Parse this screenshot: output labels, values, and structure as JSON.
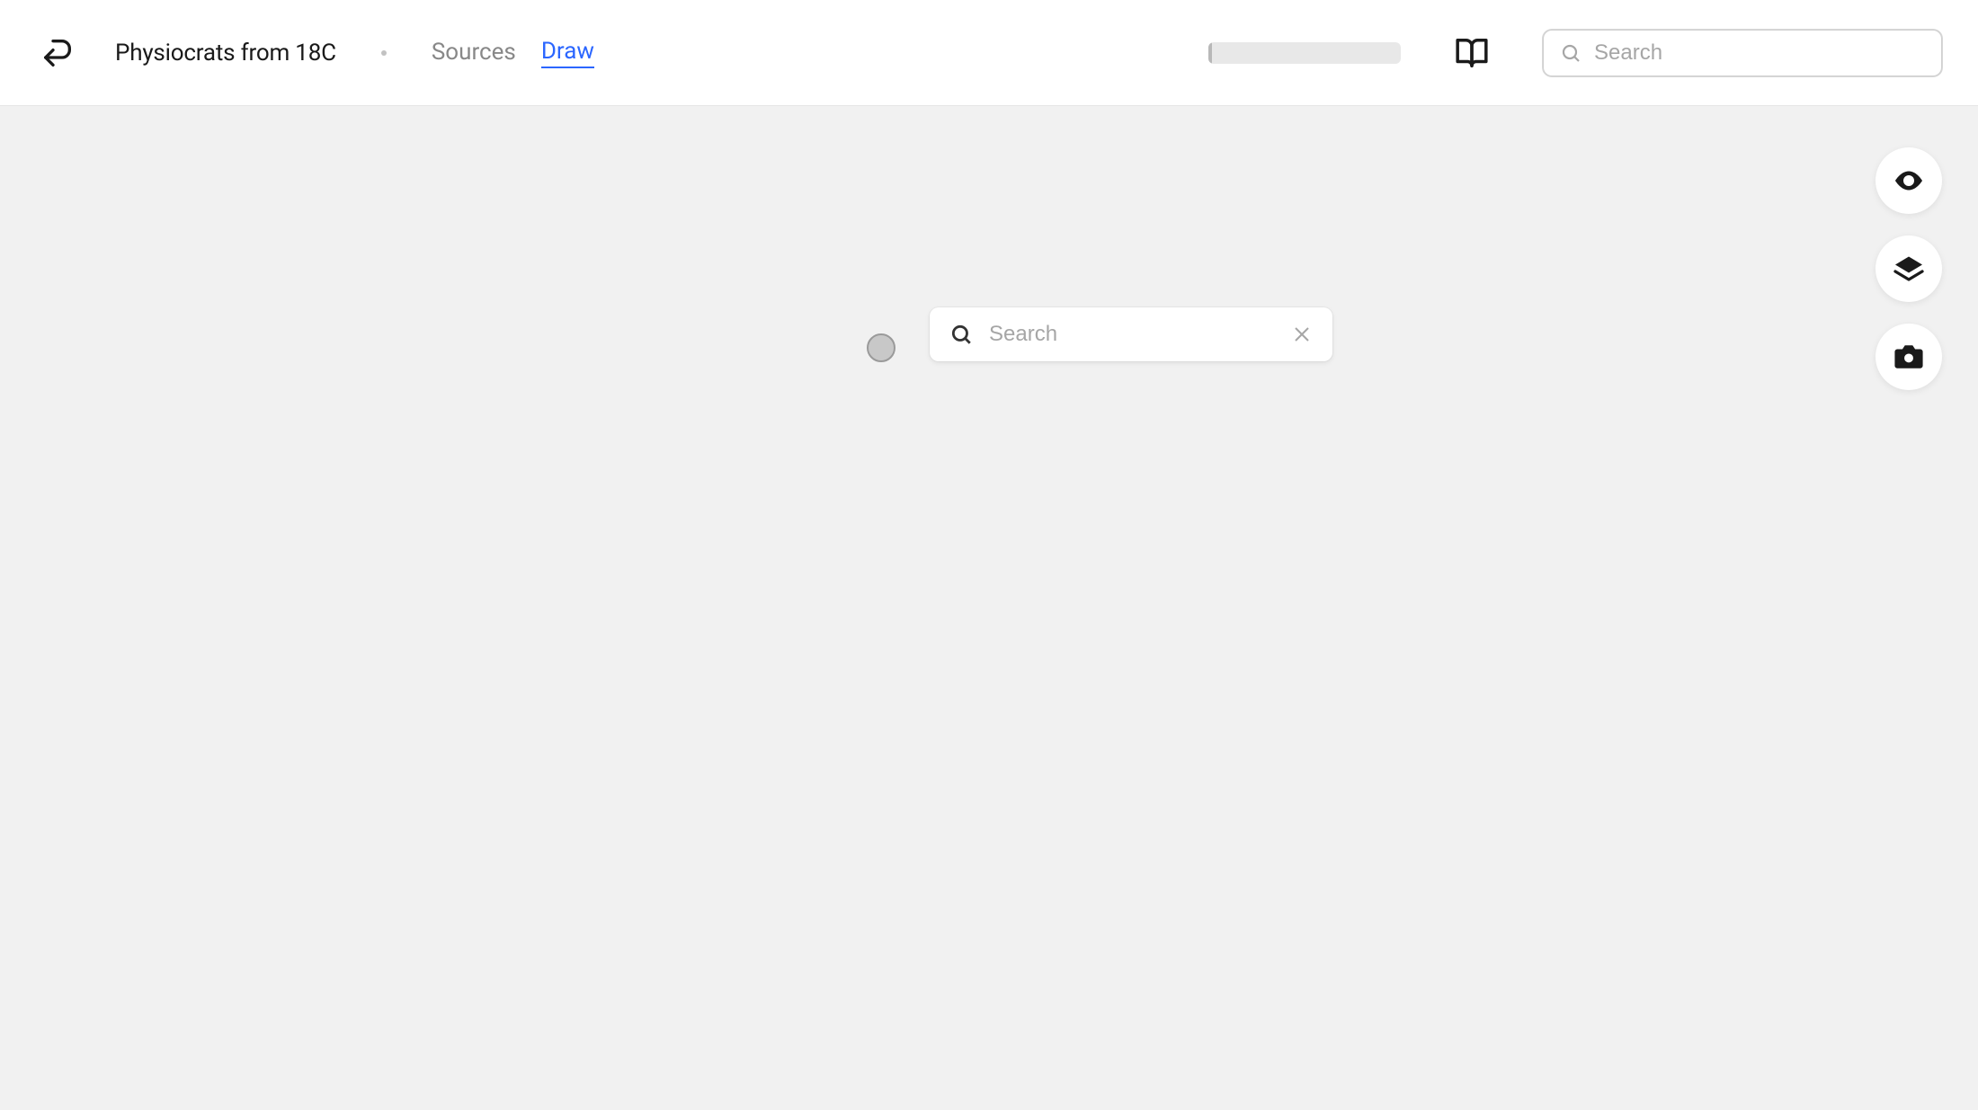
{
  "header": {
    "title": "Physiocrats from 18C",
    "tabs": [
      {
        "label": "Sources",
        "active": false
      },
      {
        "label": "Draw",
        "active": true
      }
    ],
    "search_placeholder": "Search",
    "progress_percent": 2
  },
  "canvas": {
    "node_search_placeholder": "Search"
  },
  "side_tools": [
    {
      "name": "eye-icon"
    },
    {
      "name": "layers-icon"
    },
    {
      "name": "camera-icon"
    }
  ],
  "colors": {
    "background": "#f1f1f1",
    "header_bg": "#ffffff",
    "accent": "#2b66ff",
    "text": "#1a1a1a",
    "text_muted": "#888888",
    "border": "#d0d0d0"
  }
}
